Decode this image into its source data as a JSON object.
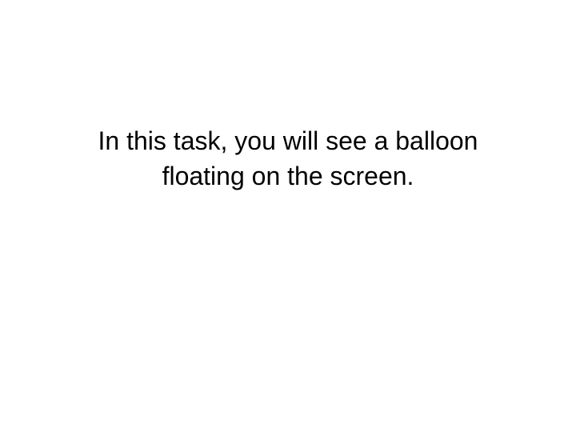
{
  "slide": {
    "text_lines": [
      "In this task, you will see a balloon",
      "floating on the screen."
    ]
  }
}
